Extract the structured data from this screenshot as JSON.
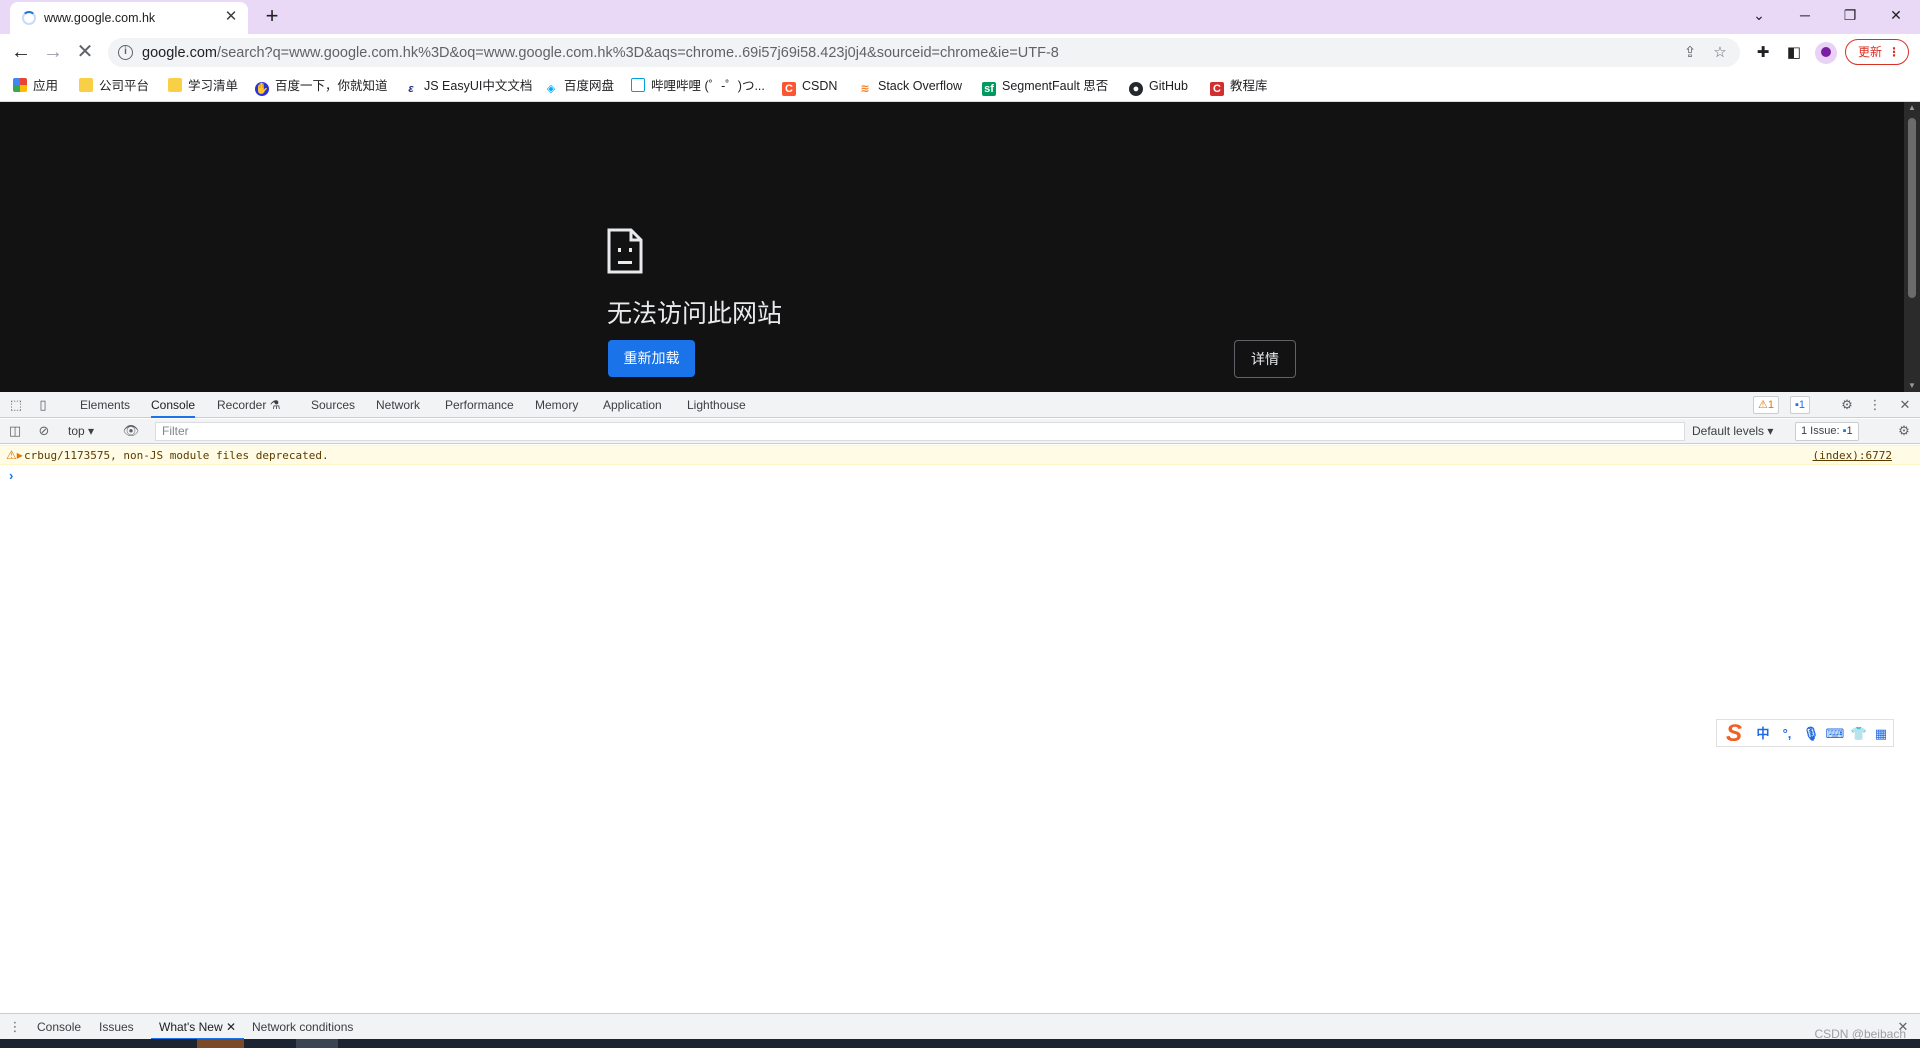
{
  "browser": {
    "tab": {
      "title": "www.google.com.hk"
    },
    "url": {
      "host": "google.com",
      "path": "/search?q=www.google.com.hk%3D&oq=www.google.com.hk%3D&aqs=chrome..69i57j69i58.423j0j4&sourceid=chrome&ie=UTF-8"
    },
    "update_label": "更新",
    "bookmarks": [
      {
        "label": "应用",
        "icon": "apps-grid-icon"
      },
      {
        "label": "公司平台",
        "icon": "folder-icon"
      },
      {
        "label": "学习清单",
        "icon": "folder-icon"
      },
      {
        "label": "百度一下，你就知道",
        "icon": "baidu-icon"
      },
      {
        "label": "JS EasyUI中文文档",
        "icon": "easyui-icon"
      },
      {
        "label": "百度网盘",
        "icon": "baidu-pan-icon"
      },
      {
        "label": "哔哩哔哩 (゜-゜)つ...",
        "icon": "bilibili-icon"
      },
      {
        "label": "CSDN",
        "icon": "csdn-icon"
      },
      {
        "label": "Stack Overflow",
        "icon": "stackoverflow-icon"
      },
      {
        "label": "SegmentFault 思否",
        "icon": "segmentfault-icon"
      },
      {
        "label": "GitHub",
        "icon": "github-icon"
      },
      {
        "label": "教程库",
        "icon": "tutorial-icon"
      }
    ]
  },
  "error_page": {
    "title": "无法访问此网站",
    "reload_label": "重新加载",
    "details_label": "详情"
  },
  "devtools": {
    "tabs": [
      "Elements",
      "Console",
      "Recorder",
      "Sources",
      "Network",
      "Performance",
      "Memory",
      "Application",
      "Lighthouse"
    ],
    "active_tab": "Console",
    "warning_badge": "1",
    "message_badge": "1",
    "context": "top",
    "filter_placeholder": "Filter",
    "levels_label": "Default levels",
    "issues_label": "1 Issue:",
    "issues_count": "1",
    "console_messages": [
      {
        "level": "warning",
        "text": "crbug/1173575, non-JS module files deprecated.",
        "source": "(index):6772"
      }
    ],
    "drawer_tabs": [
      "Console",
      "Issues",
      "What's New",
      "Network conditions"
    ],
    "drawer_active": "What's New"
  },
  "watermark": "CSDN @beibach",
  "colors": {
    "accent": "#1a73e8",
    "tabstrip": "#e9d9f6",
    "error_bg": "#121212",
    "update_red": "#d93025",
    "warning_bg": "#fffbe5"
  }
}
